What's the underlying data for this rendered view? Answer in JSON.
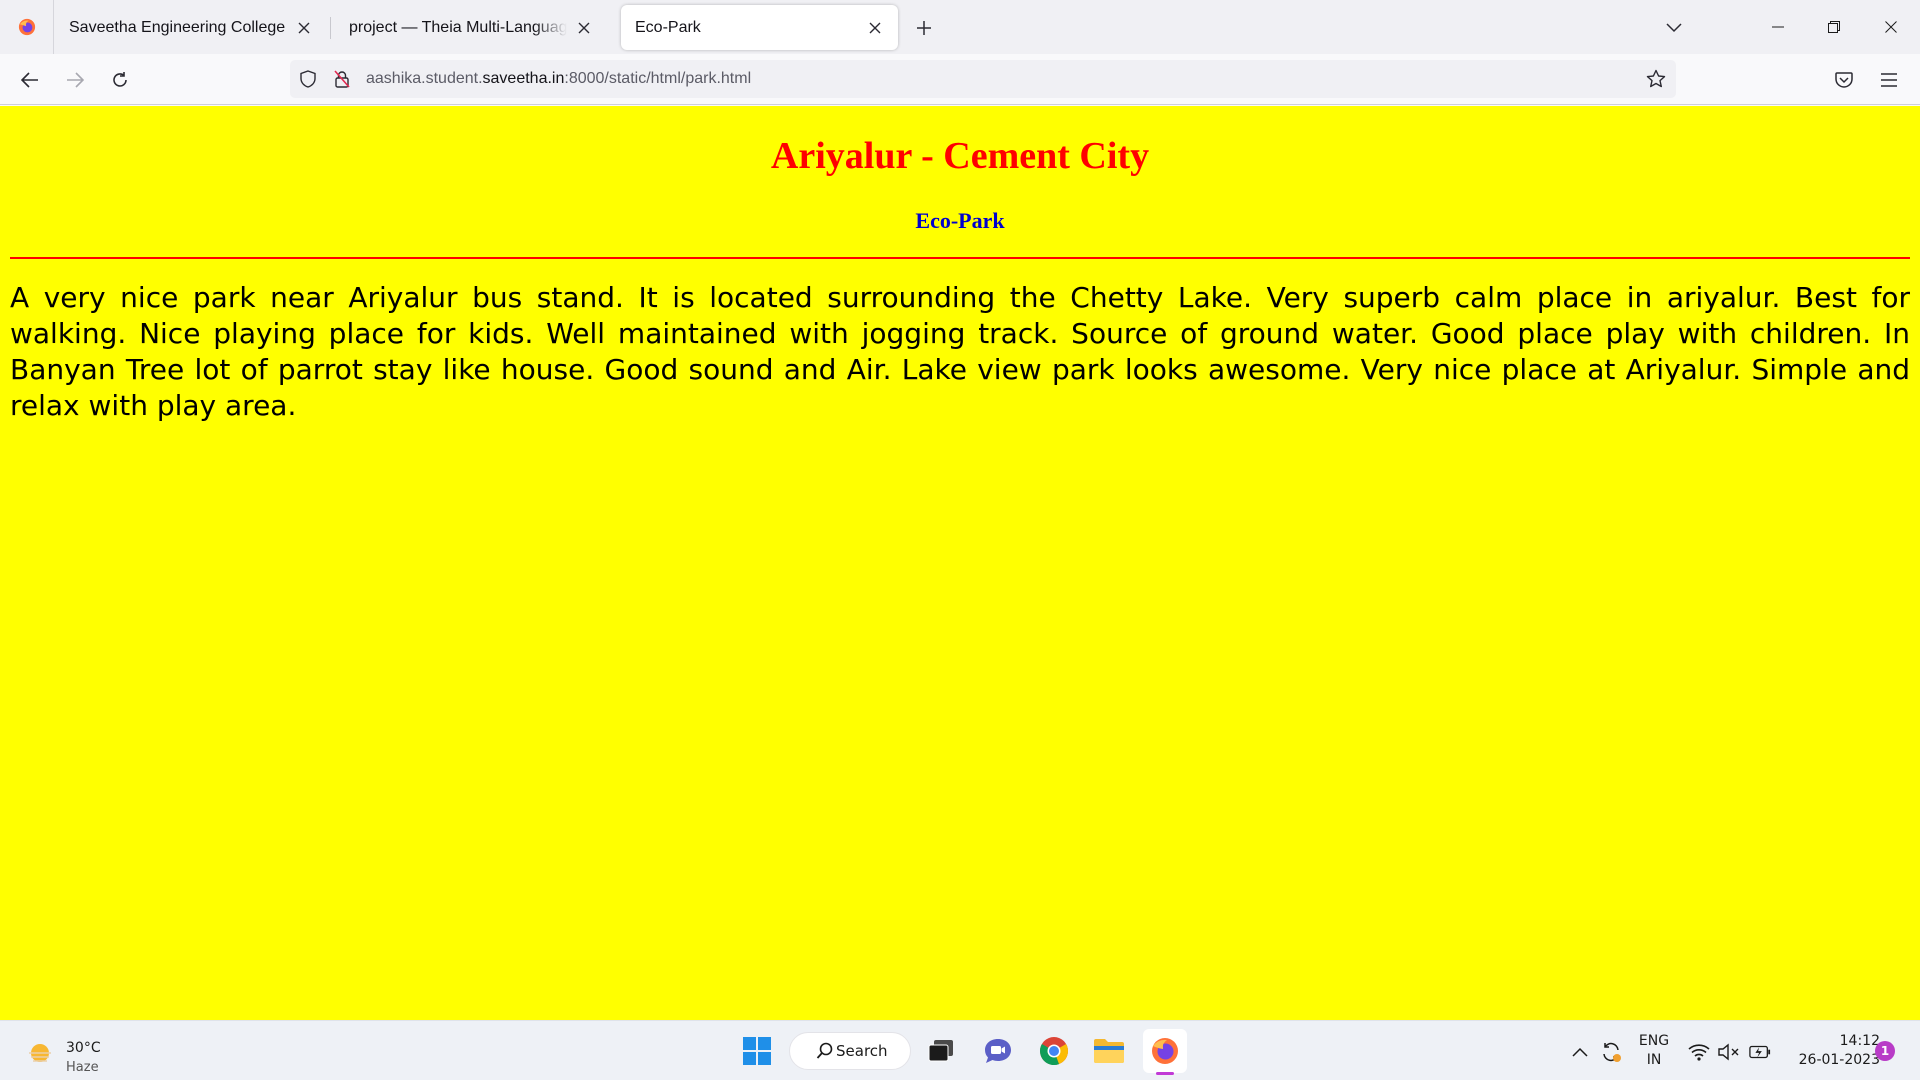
{
  "browser": {
    "tabs": [
      {
        "title": "Saveetha Engineering College",
        "active": false
      },
      {
        "title": "project — Theia Multi-Language Explorer",
        "active": false
      },
      {
        "title": "Eco-Park",
        "active": true
      }
    ],
    "url": {
      "prefix": "aashika.student.",
      "host": "saveetha.in",
      "suffix": ":8000/static/html/park.html"
    },
    "accent_color": "#ff0000"
  },
  "page": {
    "background_color": "#ffff00",
    "heading": "Ariyalur - Cement City",
    "heading_color": "#ff0000",
    "subheading": "Eco-Park",
    "subheading_color": "#0000cc",
    "paragraph": "A very nice park near Ariyalur bus stand. It is located surrounding the Chetty Lake. Very superb calm place in ariyalur. Best for walking. Nice playing place for kids. Well maintained with jogging track. Source of ground water. Good place play with children. In Banyan Tree lot of parrot stay like house. Good sound and Air. Lake view park looks awesome. Very nice place at Ariyalur. Simple and relax with play area."
  },
  "taskbar": {
    "weather": {
      "temperature": "30°C",
      "condition": "Haze"
    },
    "search_label": "Search",
    "pinned_apps": [
      "windows-start",
      "search",
      "task-view",
      "teams-chat",
      "chrome",
      "file-explorer",
      "firefox"
    ],
    "tray": {
      "language_line1": "ENG",
      "language_line2": "IN",
      "time": "14:12",
      "date": "26-01-2023",
      "notification_count": "1"
    }
  }
}
